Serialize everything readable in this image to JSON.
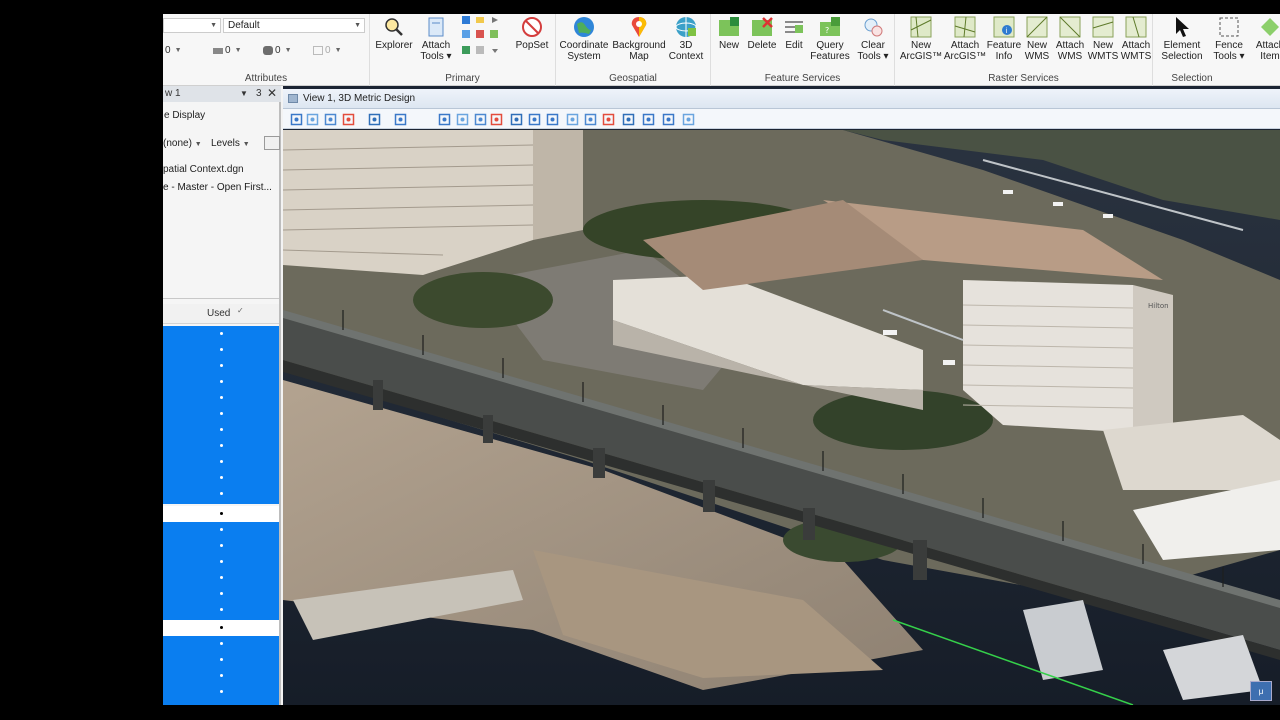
{
  "ribbon": {
    "attributes": {
      "group_label": "Attributes",
      "template_value": "Default",
      "color_value": "0",
      "weight_value": "0",
      "style_value": "0",
      "transparency_value": "0"
    },
    "primary": {
      "group_label": "Primary",
      "explorer_label": "Explorer",
      "attach_tools_label": "Attach\nTools ▾",
      "popset_label": "PopSet"
    },
    "geospatial": {
      "group_label": "Geospatial",
      "coordinate_system_label": "Coordinate\nSystem",
      "background_map_label": "Background\nMap",
      "context_3d_label": "3D\nContext"
    },
    "feature_services": {
      "group_label": "Feature Services",
      "new_label": "New",
      "delete_label": "Delete",
      "edit_label": "Edit",
      "query_features_label": "Query\nFeatures",
      "clear_tools_label": "Clear\nTools ▾"
    },
    "raster_services": {
      "group_label": "Raster Services",
      "new_arcgis_label": "New\nArcGIS™",
      "attach_arcgis_label": "Attach\nArcGIS™",
      "feature_info_label": "Feature\nInfo",
      "new_wms_label": "New\nWMS",
      "attach_wms_label": "Attach\nWMS",
      "new_wmts_label": "New\nWMTS",
      "attach_wmts_label": "Attach\nWMTS"
    },
    "selection": {
      "group_label": "Selection",
      "element_selection_label": "Element\nSelection",
      "fence_tools_label": "Fence\nTools ▾",
      "attach_item_label": "Attach\nItem"
    }
  },
  "panel": {
    "title": "w 1",
    "pin_label": "3",
    "display_label": "e Display",
    "filter_value": "(none)",
    "levels_label": "Levels",
    "file_1": "patial Context.dgn",
    "file_2": "e - Master - Open First...",
    "used_header": "Used"
  },
  "view": {
    "title": "View 1, 3D Metric Design",
    "watermark": "μ"
  },
  "colors": {
    "accent_blue": "#0a7ef0",
    "ribbon_bg": "#f7f7f7",
    "panel_bg": "#f5f5f5"
  }
}
